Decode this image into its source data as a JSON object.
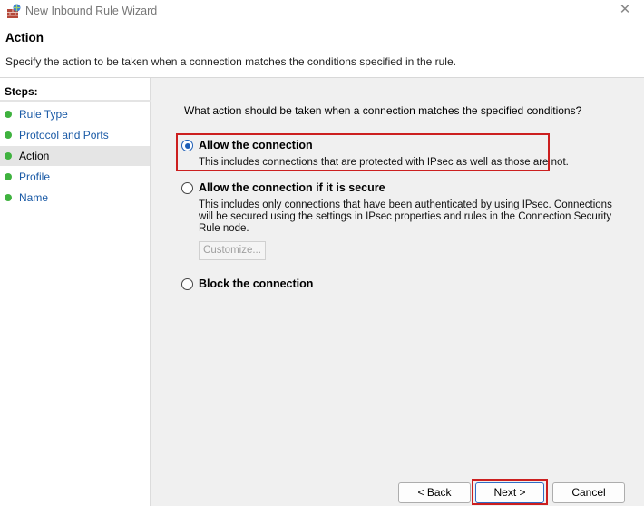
{
  "window": {
    "title": "New Inbound Rule Wizard",
    "close_glyph": "✕",
    "icon": "firewall-icon"
  },
  "header": {
    "title": "Action",
    "description": "Specify the action to be taken when a connection matches the conditions specified in the rule."
  },
  "steps": {
    "heading": "Steps:",
    "items": [
      {
        "label": "Rule Type"
      },
      {
        "label": "Protocol and Ports"
      },
      {
        "label": "Action"
      },
      {
        "label": "Profile"
      },
      {
        "label": "Name"
      }
    ],
    "current": "Action",
    "dot_color": "#3fb23f"
  },
  "main": {
    "question": "What action should be taken when a connection matches the specified conditions?",
    "options": [
      {
        "label": "Allow the connection",
        "desc": "This includes connections that are protected with IPsec as well as those are not.",
        "selected": true
      },
      {
        "label": "Allow the connection if it is secure",
        "desc_lines": [
          "This includes only connections that have been authenticated by using IPsec.  Connections",
          "will be secured using the settings in IPsec properties and rules in the Connection Security",
          "Rule node."
        ],
        "selected": false
      },
      {
        "label": "Block the connection",
        "selected": false
      }
    ],
    "customize_label": "Customize...",
    "highlight_color": "#cc1f1f"
  },
  "footer": {
    "back_label": "< Back",
    "next_label": "Next >",
    "cancel_label": "Cancel"
  }
}
